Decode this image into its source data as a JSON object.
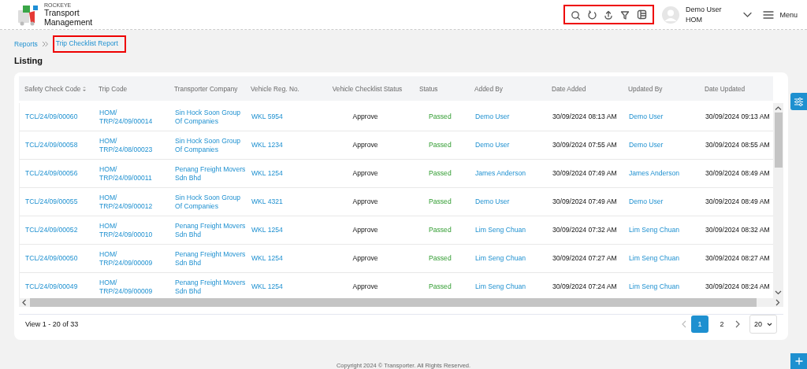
{
  "header": {
    "brand_small": "ROCKEYE",
    "brand": "Transport Management",
    "user_name": "Demo User",
    "user_branch": "HOM",
    "menu": "Menu"
  },
  "breadcrumb": [
    {
      "label": "Reports",
      "highlighted": false
    },
    {
      "label": "Trip Checklist Report",
      "highlighted": true
    }
  ],
  "heading": "Listing",
  "table": {
    "columns": [
      {
        "label": "Safety Check Code",
        "kind": "link",
        "sortable": true
      },
      {
        "label": "Trip Code",
        "kind": "code",
        "sortable": false
      },
      {
        "label": "Transporter Company",
        "kind": "link",
        "sortable": false
      },
      {
        "label": "Vehicle Reg. No.",
        "kind": "link",
        "sortable": false
      },
      {
        "label": "Vehicle Checklist Status",
        "kind": "center",
        "sortable": false
      },
      {
        "label": "Status",
        "kind": "status",
        "sortable": false
      },
      {
        "label": "Added By",
        "kind": "link",
        "sortable": false
      },
      {
        "label": "Date Added",
        "kind": "text",
        "sortable": false
      },
      {
        "label": "Updated By",
        "kind": "link",
        "sortable": false
      },
      {
        "label": "Date Updated",
        "kind": "text",
        "sortable": false
      }
    ],
    "rows": [
      [
        "TCL/24/09/00060",
        "HOM/TRP/24/09/00014",
        "Sin Hock Soon Group Of Companies",
        "WKL 5954",
        "Approve",
        "Passed",
        "Demo User",
        "30/09/2024 08:13 AM",
        "Demo User",
        "30/09/2024 09:13 AM"
      ],
      [
        "TCL/24/09/00058",
        "HOM/TRP/24/08/00023",
        "Sin Hock Soon Group Of Companies",
        "WKL 1234",
        "Approve",
        "Passed",
        "Demo User",
        "30/09/2024 07:55 AM",
        "Demo User",
        "30/09/2024 08:55 AM"
      ],
      [
        "TCL/24/09/00056",
        "HOM/TRP/24/09/00011",
        "Penang Freight Movers Sdn Bhd",
        "WKL 1254",
        "Approve",
        "Passed",
        "James Anderson",
        "30/09/2024 07:49 AM",
        "James Anderson",
        "30/09/2024 08:49 AM"
      ],
      [
        "TCL/24/09/00055",
        "HOM/TRP/24/09/00012",
        "Sin Hock Soon Group Of Companies",
        "WKL 4321",
        "Approve",
        "Passed",
        "Demo User",
        "30/09/2024 07:49 AM",
        "Demo User",
        "30/09/2024 08:49 AM"
      ],
      [
        "TCL/24/09/00052",
        "HOM/TRP/24/09/00010",
        "Penang Freight Movers Sdn Bhd",
        "WKL 1254",
        "Approve",
        "Passed",
        "Lim Seng Chuan",
        "30/09/2024 07:32 AM",
        "Lim Seng Chuan",
        "30/09/2024 08:32 AM"
      ],
      [
        "TCL/24/09/00050",
        "HOM/TRP/24/09/00009",
        "Penang Freight Movers Sdn Bhd",
        "WKL 1254",
        "Approve",
        "Passed",
        "Lim Seng Chuan",
        "30/09/2024 07:27 AM",
        "Lim Seng Chuan",
        "30/09/2024 08:27 AM"
      ],
      [
        "TCL/24/09/00049",
        "HOM/TRP/24/09/00009",
        "Penang Freight Movers Sdn Bhd",
        "WKL 1254",
        "Approve",
        "Passed",
        "Lim Seng Chuan",
        "30/09/2024 07:24 AM",
        "Lim Seng Chuan",
        "30/09/2024 08:24 AM"
      ]
    ]
  },
  "pager": {
    "summary": "View 1 - 20 of 33",
    "pages": [
      {
        "label": "1",
        "selected": true
      },
      {
        "label": "2",
        "selected": false
      }
    ],
    "page_size": "20"
  },
  "footer": "Copyright 2024 © Transporter. All Rights Reserved."
}
